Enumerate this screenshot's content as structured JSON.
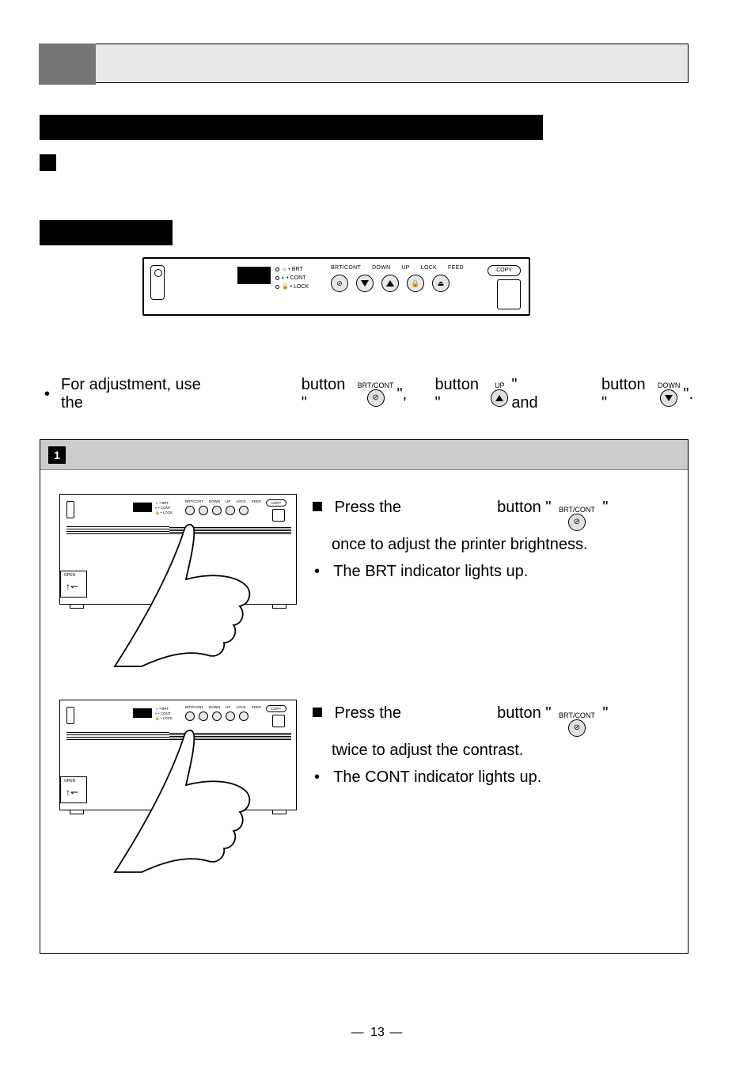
{
  "header": {
    "section_tab": "",
    "title_bar": ""
  },
  "panel": {
    "indicators": {
      "brt": "BRT",
      "cont": "CONT",
      "lock": "LOCK",
      "brt_sym": "☼",
      "cont_sym": "◐",
      "lock_sym": "🔒"
    },
    "labels": {
      "brt_cont": "BRT/CONT",
      "down": "DOWN",
      "up": "UP",
      "lock": "LOCK",
      "feed": "FEED",
      "copy": "COPY"
    }
  },
  "adjust_line": {
    "prefix": "For adjustment, use the",
    "mid1": "button \"",
    "mid1b": "\",",
    "mid2": "button \"",
    "mid2b": "\" and",
    "mid3": "button \"",
    "mid3b": "\".",
    "icon_labels": {
      "brt_cont": "BRT/CONT",
      "up": "UP",
      "down": "DOWN"
    }
  },
  "step": {
    "number": "1",
    "row1": {
      "l1a": "Press the",
      "l1b": "button \"",
      "l1c": "\"",
      "l2": "once to adjust the printer brightness.",
      "l3": "The BRT indicator lights up.",
      "icon_label": "BRT/CONT"
    },
    "row2": {
      "l1a": "Press the",
      "l1b": "button \"",
      "l1c": "\"",
      "l2": "twice to adjust the contrast.",
      "l3": "The CONT indicator lights up.",
      "icon_label": "BRT/CONT"
    },
    "printer_open_label": "OPEN"
  },
  "page_number": "13"
}
